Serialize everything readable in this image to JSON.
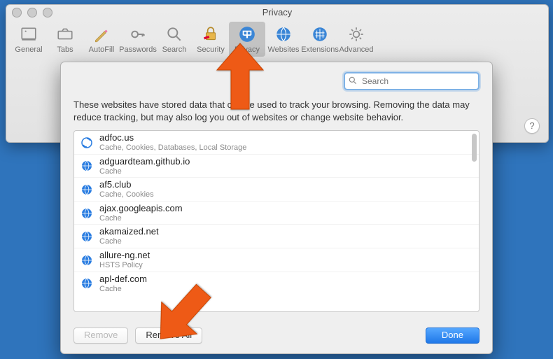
{
  "window": {
    "title": "Privacy"
  },
  "toolbar": {
    "items": [
      {
        "id": "general",
        "label": "General"
      },
      {
        "id": "tabs",
        "label": "Tabs"
      },
      {
        "id": "autofill",
        "label": "AutoFill"
      },
      {
        "id": "passwords",
        "label": "Passwords"
      },
      {
        "id": "search",
        "label": "Search"
      },
      {
        "id": "security",
        "label": "Security"
      },
      {
        "id": "privacy",
        "label": "Privacy"
      },
      {
        "id": "websites",
        "label": "Websites"
      },
      {
        "id": "extensions",
        "label": "Extensions"
      },
      {
        "id": "advanced",
        "label": "Advanced"
      }
    ],
    "selected": "privacy"
  },
  "help_label": "?",
  "sheet": {
    "search_placeholder": "Search",
    "description": "These websites have stored data that can be used to track your browsing. Removing the data may reduce tracking, but may also log you out of websites or change website behavior.",
    "sites": [
      {
        "domain": "adfoc.us",
        "detail": "Cache, Cookies, Databases, Local Storage",
        "icon": "custom"
      },
      {
        "domain": "adguardteam.github.io",
        "detail": "Cache",
        "icon": "globe"
      },
      {
        "domain": "af5.club",
        "detail": "Cache, Cookies",
        "icon": "globe"
      },
      {
        "domain": "ajax.googleapis.com",
        "detail": "Cache",
        "icon": "globe"
      },
      {
        "domain": "akamaized.net",
        "detail": "Cache",
        "icon": "globe"
      },
      {
        "domain": "allure-ng.net",
        "detail": "HSTS Policy",
        "icon": "globe"
      },
      {
        "domain": "apl-def.com",
        "detail": "Cache",
        "icon": "globe"
      }
    ],
    "buttons": {
      "remove": "Remove",
      "remove_all": "Remove All",
      "done": "Done"
    }
  },
  "colors": {
    "accent": "#1f78e8",
    "arrow": "#ee5a16"
  }
}
